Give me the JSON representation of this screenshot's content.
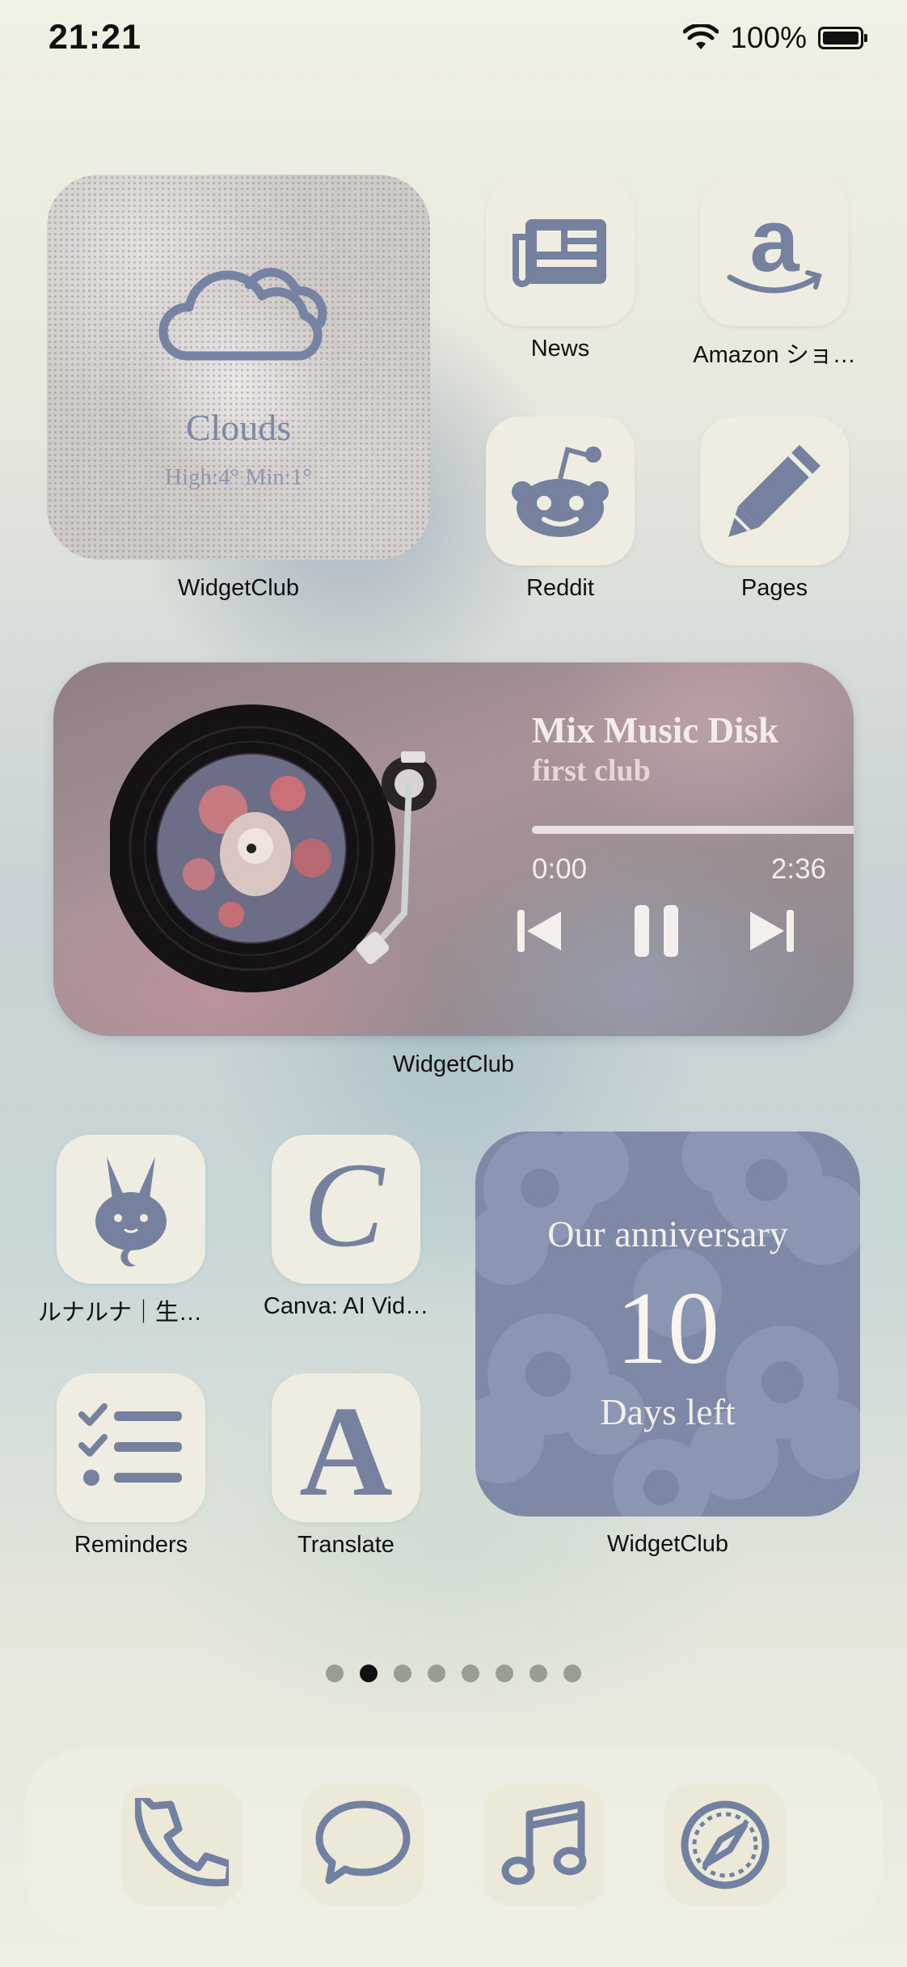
{
  "status_bar": {
    "time": "21:21",
    "battery_percent": "100%",
    "battery_level": 1.0
  },
  "apps": {
    "news": {
      "label": "News",
      "icon": "newspaper-icon"
    },
    "amazon": {
      "label": "Amazon ショ…",
      "icon": "amazon-icon"
    },
    "reddit": {
      "label": "Reddit",
      "icon": "reddit-icon"
    },
    "pages": {
      "label": "Pages",
      "icon": "pencil-icon"
    },
    "lunaluna": {
      "label": "ルナルナ｜生理…",
      "icon": "rabbit-icon"
    },
    "canva": {
      "label": "Canva: AI Vid…",
      "icon": "canva-icon"
    },
    "reminders": {
      "label": "Reminders",
      "icon": "checklist-icon"
    },
    "translate": {
      "label": "Translate",
      "icon": "letter-a-icon"
    }
  },
  "weather_widget": {
    "condition": "Clouds",
    "high_low": "High:4° Min:1°",
    "label": "WidgetClub"
  },
  "music_widget": {
    "title": "Mix Music Disk",
    "artist": "first club",
    "current_time": "0:00",
    "total_time": "2:36",
    "progress": 0.0,
    "label": "WidgetClub"
  },
  "anniversary_widget": {
    "line1": "Our anniversary",
    "number": "10",
    "line2": "Days left",
    "label": "WidgetClub"
  },
  "page_indicator": {
    "count": 8,
    "active_index": 1
  },
  "dock": [
    {
      "icon": "phone-icon"
    },
    {
      "icon": "message-icon"
    },
    {
      "icon": "music-note-icon"
    },
    {
      "icon": "compass-icon"
    }
  ],
  "colors": {
    "icon_bg": "#efede2",
    "icon_fg": "#76819f",
    "anniversary_bg": "#7d89a6"
  }
}
